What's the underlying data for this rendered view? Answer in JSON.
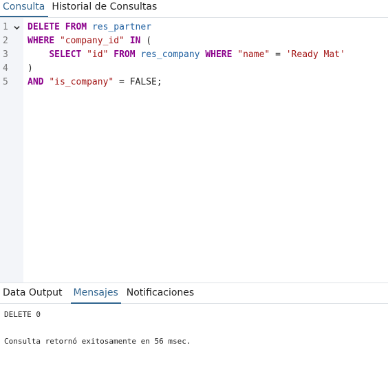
{
  "top_tabs": [
    {
      "label": "Consulta",
      "active": true
    },
    {
      "label": "Historial de Consultas",
      "active": false
    }
  ],
  "editor": {
    "line_numbers": [
      "1",
      "2",
      "3",
      "4",
      "5"
    ],
    "fold_icon": "chevron-down-icon",
    "lines": [
      [
        {
          "t": "DELETE",
          "k": "kw"
        },
        {
          "t": " ",
          "k": "op"
        },
        {
          "t": "FROM",
          "k": "kw"
        },
        {
          "t": " ",
          "k": "op"
        },
        {
          "t": "res_partner",
          "k": "id"
        }
      ],
      [
        {
          "t": "WHERE",
          "k": "kw"
        },
        {
          "t": " ",
          "k": "op"
        },
        {
          "t": "\"company_id\"",
          "k": "str"
        },
        {
          "t": " ",
          "k": "op"
        },
        {
          "t": "IN",
          "k": "kw"
        },
        {
          "t": " (",
          "k": "op"
        }
      ],
      [
        {
          "t": "    ",
          "k": "op"
        },
        {
          "t": "SELECT",
          "k": "kw"
        },
        {
          "t": " ",
          "k": "op"
        },
        {
          "t": "\"id\"",
          "k": "str"
        },
        {
          "t": " ",
          "k": "op"
        },
        {
          "t": "FROM",
          "k": "kw"
        },
        {
          "t": " ",
          "k": "op"
        },
        {
          "t": "res_company",
          "k": "id"
        },
        {
          "t": " ",
          "k": "op"
        },
        {
          "t": "WHERE",
          "k": "kw"
        },
        {
          "t": " ",
          "k": "op"
        },
        {
          "t": "\"name\"",
          "k": "str"
        },
        {
          "t": " = ",
          "k": "op"
        },
        {
          "t": "'Ready Mat'",
          "k": "str"
        }
      ],
      [
        {
          "t": ")",
          "k": "op"
        }
      ],
      [
        {
          "t": "AND",
          "k": "kw"
        },
        {
          "t": " ",
          "k": "op"
        },
        {
          "t": "\"is_company\"",
          "k": "str"
        },
        {
          "t": " = FALSE;",
          "k": "op"
        }
      ]
    ]
  },
  "bottom_tabs": [
    {
      "label": "Data Output",
      "active": false
    },
    {
      "label": "Mensajes",
      "active": true
    },
    {
      "label": "Notificaciones",
      "active": false
    }
  ],
  "messages": {
    "line1": "DELETE 0",
    "line2": "Consulta retornó exitosamente en 56 msec."
  },
  "colors": {
    "accent": "#326690",
    "keyword": "#8b008b",
    "identifier": "#1e5fa0",
    "string": "#a31515",
    "gutter_bg": "#f3f5f9"
  }
}
